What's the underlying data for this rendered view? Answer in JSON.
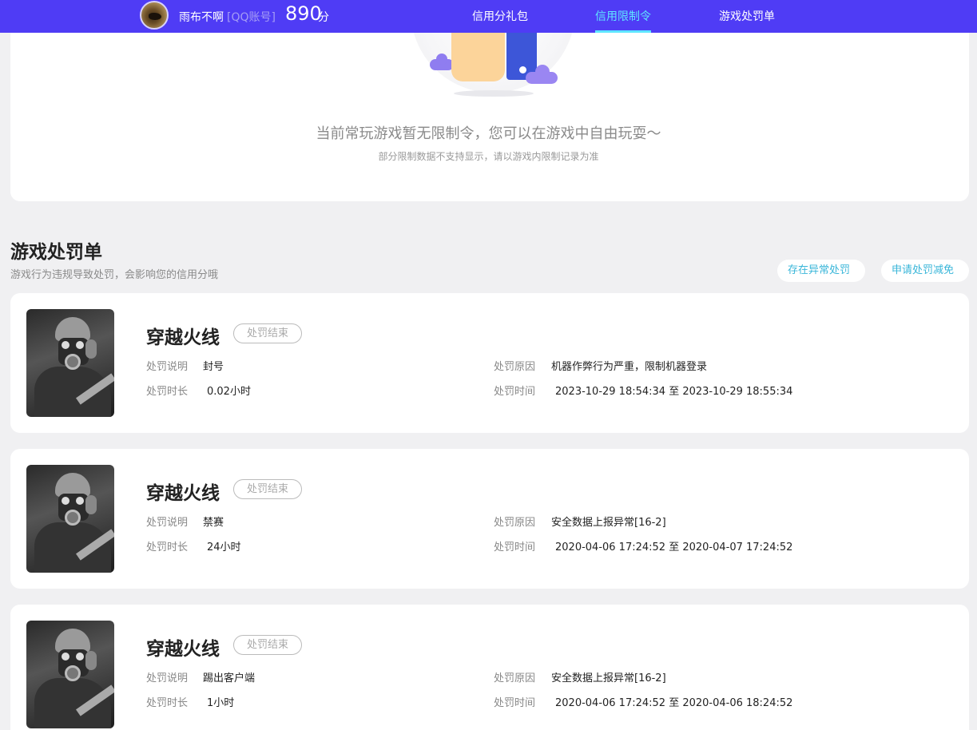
{
  "header": {
    "username": "雨布不啊",
    "account_type": "[QQ账号]",
    "score": "890",
    "score_unit": "分",
    "tabs": [
      {
        "label": "信用分礼包",
        "active": false
      },
      {
        "label": "信用限制令",
        "active": true
      },
      {
        "label": "游戏处罚单",
        "active": false
      }
    ],
    "accent_color": "#4f3cf5",
    "active_tab_color": "#5fe6ff"
  },
  "restriction_card": {
    "empty_message": "当前常玩游戏暂无限制令，您可以在游戏中自由玩耍～",
    "note": "部分限制数据不支持显示，请以游戏内限制记录为准"
  },
  "penalty_section": {
    "title": "游戏处罚单",
    "description": "游戏行为违规导致处罚，会影响您的信用分哦",
    "buttons": [
      {
        "label": "存在异常处罚"
      },
      {
        "label": "申请处罚减免"
      }
    ],
    "field_labels": {
      "description": "处罚说明",
      "duration": "处罚时长",
      "reason": "处罚原因",
      "time": "处罚时间"
    },
    "items": [
      {
        "game": "穿越火线",
        "status": "处罚结束",
        "description": "封号",
        "duration": "0.02小时",
        "reason": "机器作弊行为严重，限制机器登录",
        "time": "2023-10-29 18:54:34 至 2023-10-29 18:55:34"
      },
      {
        "game": "穿越火线",
        "status": "处罚结束",
        "description": "禁赛",
        "duration": "24小时",
        "reason": "安全数据上报异常[16-2]",
        "time": "2020-04-06 17:24:52 至 2020-04-07 17:24:52"
      },
      {
        "game": "穿越火线",
        "status": "处罚结束",
        "description": "踢出客户端",
        "duration": "1小时",
        "reason": "安全数据上报异常[16-2]",
        "time": "2020-04-06 17:24:52 至 2020-04-06 18:24:52"
      }
    ]
  }
}
